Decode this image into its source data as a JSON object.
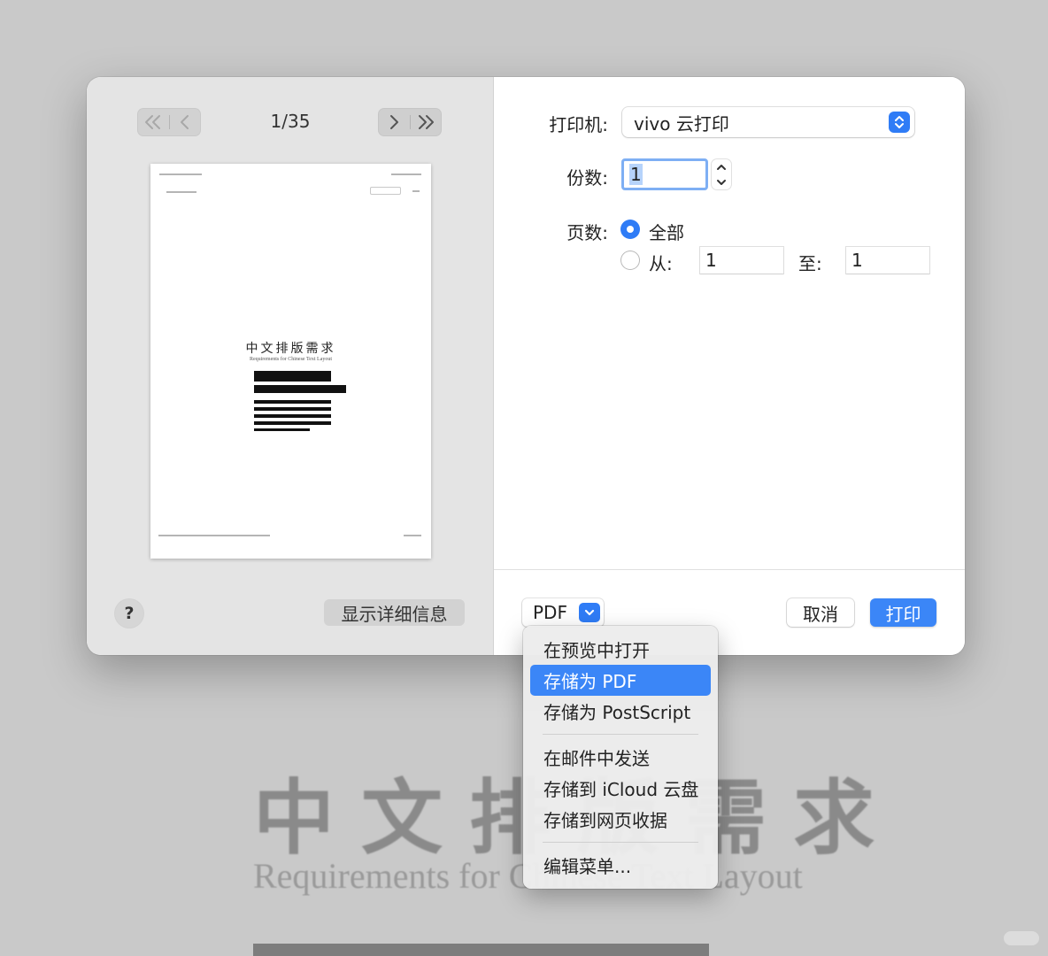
{
  "background": {
    "title": "中文排版需求",
    "subtitle": "Requirements for Chinese Text Layout"
  },
  "preview": {
    "page_counter": "1/35",
    "doc_title": "中文排版需求",
    "doc_subtitle": "Requirements for Chinese Text Layout",
    "details_label": "显示详细信息",
    "help_label": "?"
  },
  "form": {
    "printer_label": "打印机:",
    "printer_value": "vivo 云打印",
    "copies_label": "份数:",
    "copies_value": "1",
    "pages_label": "页数:",
    "pages_all_label": "全部",
    "pages_from_label": "从:",
    "pages_from_value": "1",
    "pages_to_label": "至:",
    "pages_to_value": "1"
  },
  "bottom": {
    "pdf_label": "PDF",
    "cancel_label": "取消",
    "print_label": "打印"
  },
  "pdf_menu": {
    "items": [
      "在预览中打开",
      "存储为 PDF",
      "存储为 PostScript",
      "在邮件中发送",
      "存储到 iCloud 云盘",
      "存储到网页收据",
      "编辑菜单..."
    ],
    "selected_index": 1
  },
  "colors": {
    "accent": "#2f7cf6",
    "print_button": "#3b86f7"
  }
}
